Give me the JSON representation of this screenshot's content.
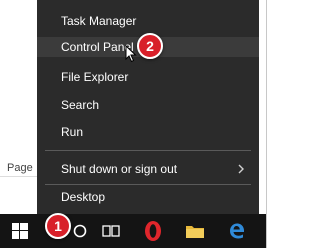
{
  "background": {
    "page_label": "Page"
  },
  "menu": {
    "items": [
      {
        "label": "Task Manager"
      },
      {
        "label": "Control Panel"
      },
      {
        "label": "File Explorer"
      },
      {
        "label": "Search"
      },
      {
        "label": "Run"
      },
      {
        "label": "Shut down or sign out"
      },
      {
        "label": "Desktop"
      }
    ]
  },
  "badges": {
    "control_panel": "2",
    "start": "1"
  },
  "icons": {
    "start": "windows-logo-icon",
    "cortana": "cortana-icon",
    "task_view": "task-view-icon",
    "opera": "opera-icon",
    "file_explorer": "folder-icon",
    "edge": "edge-icon",
    "submenu": "chevron-right-icon",
    "cursor": "mouse-pointer-icon"
  },
  "colors": {
    "menu_bg": "#2b2b2b",
    "highlight": "#3b3b3b",
    "badge": "#d8202a",
    "taskbar": "#141414"
  }
}
